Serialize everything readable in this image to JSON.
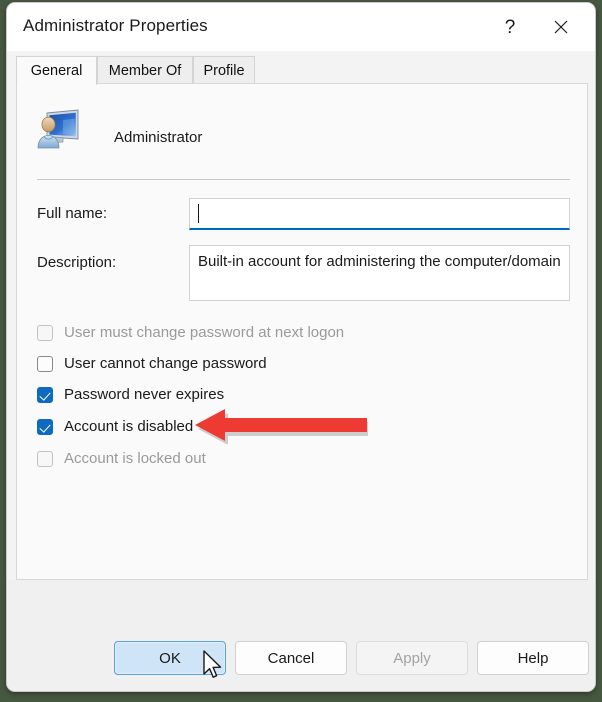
{
  "window": {
    "title": "Administrator Properties",
    "help_icon": "question-mark-icon",
    "close_icon": "close-icon"
  },
  "tabs": [
    {
      "label": "General",
      "active": true
    },
    {
      "label": "Member Of",
      "active": false
    },
    {
      "label": "Profile",
      "active": false
    }
  ],
  "account": {
    "icon": "user-account-icon",
    "name": "Administrator"
  },
  "fields": {
    "fullname": {
      "label": "Full name:",
      "value": "",
      "placeholder": "",
      "focused": true
    },
    "description": {
      "label": "Description:",
      "value": "Built-in account for administering the computer/domain",
      "placeholder": ""
    }
  },
  "checkboxes": [
    {
      "label": "User must change password at next logon",
      "checked": false,
      "enabled": false
    },
    {
      "label": "User cannot change password",
      "checked": false,
      "enabled": true
    },
    {
      "label": "Password never expires",
      "checked": true,
      "enabled": true
    },
    {
      "label": "Account is disabled",
      "checked": true,
      "enabled": true
    },
    {
      "label": "Account is locked out",
      "checked": false,
      "enabled": false
    }
  ],
  "buttons": [
    {
      "label": "OK",
      "state": "default-highlighted"
    },
    {
      "label": "Cancel",
      "state": "normal"
    },
    {
      "label": "Apply",
      "state": "disabled"
    },
    {
      "label": "Help",
      "state": "normal"
    }
  ],
  "annotation": {
    "arrow_icon": "red-left-arrow-annotation",
    "color": "#ed3b33",
    "points_at": "Account is disabled"
  },
  "cursor": {
    "icon": "mouse-pointer-icon",
    "over": "OK"
  },
  "colors": {
    "accent": "#0067c0",
    "checkbox_fill": "#0d6ac0",
    "annotation_red": "#ed3b33",
    "window_bg": "#f3f3f3",
    "panel_bg": "#fafafa",
    "desktop_bg": "#475840"
  }
}
